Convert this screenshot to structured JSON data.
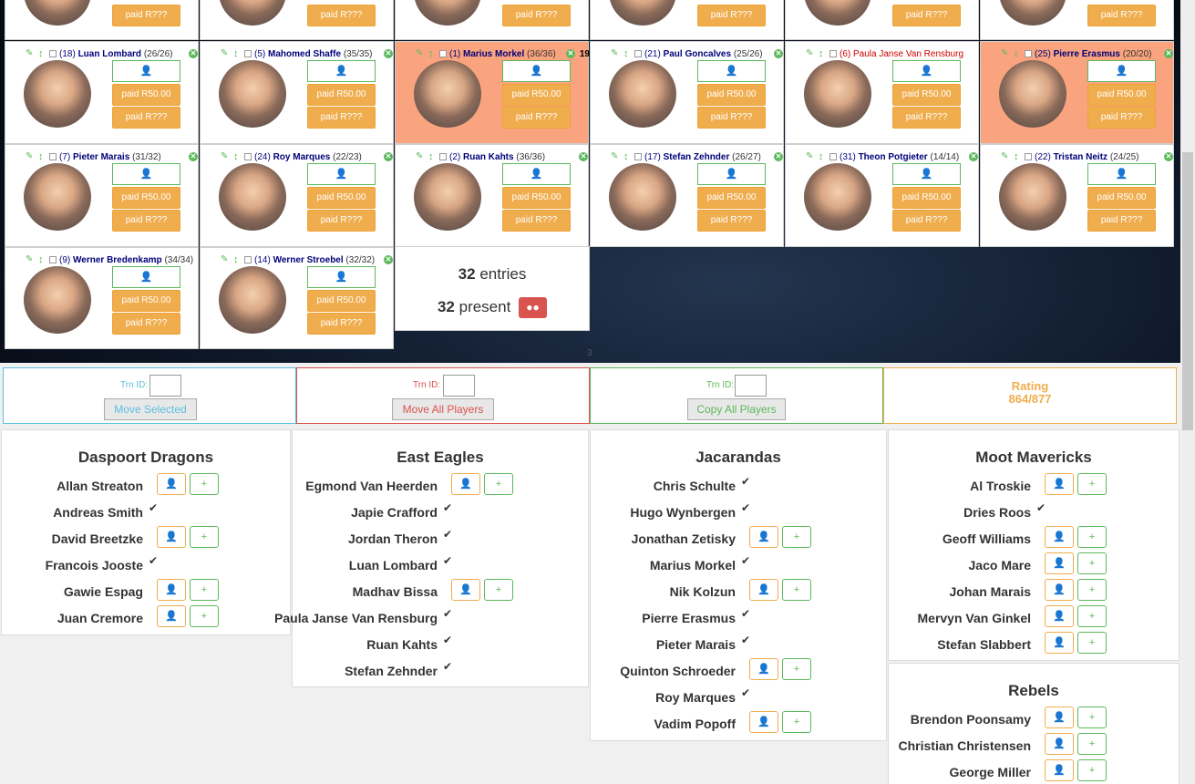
{
  "colors": {
    "highlight_card": "#f9a47e",
    "paid_button": "#f0ad4e",
    "user_button": "#5cb85c",
    "name_blue": "#00007a",
    "name_red": "#cc0000"
  },
  "top_row_partial": {
    "paid_label": "paid R???"
  },
  "players": [
    {
      "seat": "(18)",
      "name": "Luan Lombard",
      "record": "(26/26)",
      "paid1": "paid R50.00",
      "paid2": "paid R???"
    },
    {
      "seat": "(5)",
      "name": "Mahomed Shaffe",
      "record": "(35/35)",
      "paid1": "paid R50.00",
      "paid2": "paid R???"
    },
    {
      "seat": "(1)",
      "name": "Marius Morkel",
      "record": "(36/36)",
      "extra": "19",
      "paid1": "paid R50.00",
      "paid2": "paid R???"
    },
    {
      "seat": "(21)",
      "name": "Paul Goncalves",
      "record": "(25/26)",
      "paid1": "paid R50.00",
      "paid2": "paid R???"
    },
    {
      "seat": "(6)",
      "name": "Paula Janse Van Rensburg",
      "record": "",
      "paid1": "paid R50.00",
      "paid2": "paid R???"
    },
    {
      "seat": "(25)",
      "name": "Pierre Erasmus",
      "record": "(20/20)",
      "paid1": "paid R50.00",
      "paid2": "paid R???"
    },
    {
      "seat": "(7)",
      "name": "Pieter Marais",
      "record": "(31/32)",
      "paid1": "paid R50.00",
      "paid2": "paid R???"
    },
    {
      "seat": "(24)",
      "name": "Roy Marques",
      "record": "(22/23)",
      "paid1": "paid R50.00",
      "paid2": "paid R???"
    },
    {
      "seat": "(2)",
      "name": "Ruan Kahts",
      "record": "(36/36)",
      "paid1": "paid R50.00",
      "paid2": "paid R???"
    },
    {
      "seat": "(17)",
      "name": "Stefan Zehnder",
      "record": "(26/27)",
      "paid1": "paid R50.00",
      "paid2": "paid R???"
    },
    {
      "seat": "(31)",
      "name": "Theon Potgieter",
      "record": "(14/14)",
      "paid1": "paid R50.00",
      "paid2": "paid R???"
    },
    {
      "seat": "(22)",
      "name": "Tristan Neitz",
      "record": "(24/25)",
      "paid1": "paid R50.00",
      "paid2": "paid R???"
    },
    {
      "seat": "(9)",
      "name": "Werner Bredenkamp",
      "record": "(34/34)",
      "paid1": "paid R50.00",
      "paid2": "paid R???"
    },
    {
      "seat": "(14)",
      "name": "Werner Stroebel",
      "record": "(32/32)",
      "paid1": "paid R50.00",
      "paid2": "paid R???"
    }
  ],
  "summary": {
    "entries_count": "32",
    "entries_label": "entries",
    "present_count": "32",
    "present_label": "present"
  },
  "page_number": "3",
  "actions": {
    "trn_label": "Trn ID:",
    "move_selected": "Move Selected",
    "move_all": "Move All Players",
    "copy_all": "Copy All Players",
    "rating_label": "Rating",
    "rating_value": "864/877"
  },
  "teams": [
    {
      "name": "Daspoort Dragons",
      "players": [
        {
          "name": "Allan Streaton",
          "state": "buttons"
        },
        {
          "name": "Andreas Smith",
          "state": "tick"
        },
        {
          "name": "David Breetzke",
          "state": "buttons"
        },
        {
          "name": "Francois Jooste",
          "state": "tick"
        },
        {
          "name": "Gawie Espag",
          "state": "buttons"
        },
        {
          "name": "Juan Cremore",
          "state": "buttons"
        }
      ]
    },
    {
      "name": "East Eagles",
      "players": [
        {
          "name": "Egmond Van Heerden",
          "state": "buttons"
        },
        {
          "name": "Japie Crafford",
          "state": "tick"
        },
        {
          "name": "Jordan Theron",
          "state": "tick"
        },
        {
          "name": "Luan Lombard",
          "state": "tick"
        },
        {
          "name": "Madhav Bissa",
          "state": "buttons"
        },
        {
          "name": "Paula Janse Van Rensburg",
          "state": "tick"
        },
        {
          "name": "Ruan Kahts",
          "state": "tick"
        },
        {
          "name": "Stefan Zehnder",
          "state": "tick"
        }
      ]
    },
    {
      "name": "Jacarandas",
      "players": [
        {
          "name": "Chris Schulte",
          "state": "tick"
        },
        {
          "name": "Hugo Wynbergen",
          "state": "tick"
        },
        {
          "name": "Jonathan Zetisky",
          "state": "buttons"
        },
        {
          "name": "Marius Morkel",
          "state": "tick"
        },
        {
          "name": "Nik Kolzun",
          "state": "buttons"
        },
        {
          "name": "Pierre Erasmus",
          "state": "tick"
        },
        {
          "name": "Pieter Marais",
          "state": "tick"
        },
        {
          "name": "Quinton Schroeder",
          "state": "buttons"
        },
        {
          "name": "Roy Marques",
          "state": "tick"
        },
        {
          "name": "Vadim Popoff",
          "state": "buttons"
        }
      ]
    },
    {
      "name": "Moot Mavericks",
      "players": [
        {
          "name": "Al Troskie",
          "state": "buttons"
        },
        {
          "name": "Dries Roos",
          "state": "tick"
        },
        {
          "name": "Geoff Williams",
          "state": "buttons"
        },
        {
          "name": "Jaco Mare",
          "state": "buttons"
        },
        {
          "name": "Johan Marais",
          "state": "buttons"
        },
        {
          "name": "Mervyn Van Ginkel",
          "state": "buttons"
        },
        {
          "name": "Stefan Slabbert",
          "state": "buttons"
        }
      ]
    },
    {
      "name": "Rebels",
      "players": [
        {
          "name": "Brendon Poonsamy",
          "state": "buttons"
        },
        {
          "name": "Christian Christensen",
          "state": "buttons"
        },
        {
          "name": "George Miller",
          "state": "buttons"
        }
      ]
    }
  ],
  "icons": {
    "tick": "✔",
    "user": "👤",
    "user_add": "+",
    "pencil": "✎",
    "move": "↕",
    "remove": "✕"
  }
}
